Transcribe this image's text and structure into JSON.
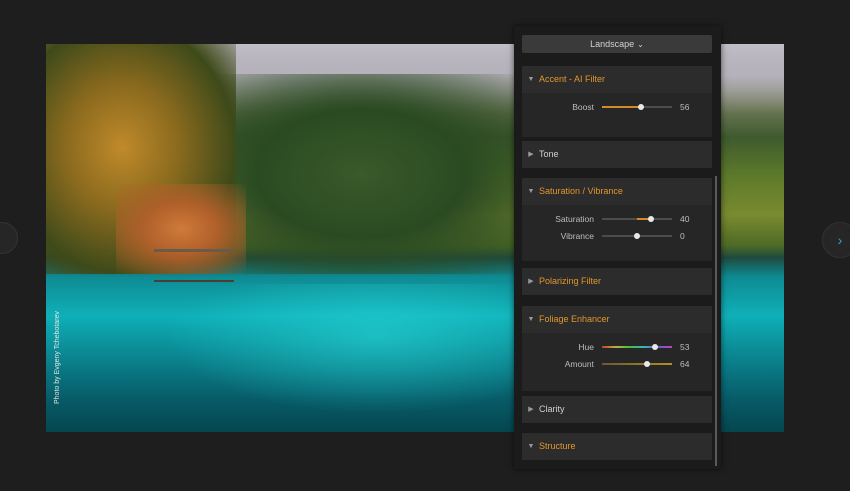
{
  "photo": {
    "credit": "Photo by Evgeny Tchebotarev"
  },
  "nav": {
    "next_icon": "›"
  },
  "panel": {
    "preset_label": "Landscape",
    "preset_chevron": "⌄",
    "sections": {
      "accent": {
        "title": "Accent - AI Filter",
        "expanded": true,
        "sliders": [
          {
            "label": "Boost",
            "value": "56",
            "level": 0.56
          }
        ]
      },
      "tone": {
        "title": "Tone",
        "expanded": false
      },
      "saturation": {
        "title": "Saturation / Vibrance",
        "expanded": true,
        "sliders": [
          {
            "label": "Saturation",
            "value": "40",
            "level": 0.7
          },
          {
            "label": "Vibrance",
            "value": "0",
            "level": 0.5
          }
        ]
      },
      "polarizing": {
        "title": "Polarizing Filter",
        "expanded": false
      },
      "foliage": {
        "title": "Foliage Enhancer",
        "expanded": true,
        "sliders": [
          {
            "label": "Hue",
            "value": "53",
            "level": 0.76
          },
          {
            "label": "Amount",
            "value": "64",
            "level": 0.64
          }
        ]
      },
      "clarity": {
        "title": "Clarity",
        "expanded": false
      },
      "structure": {
        "title": "Structure",
        "expanded": true
      }
    },
    "icons": {
      "expanded": "▼",
      "collapsed": "▶"
    },
    "accent_color": "#e2962c"
  }
}
